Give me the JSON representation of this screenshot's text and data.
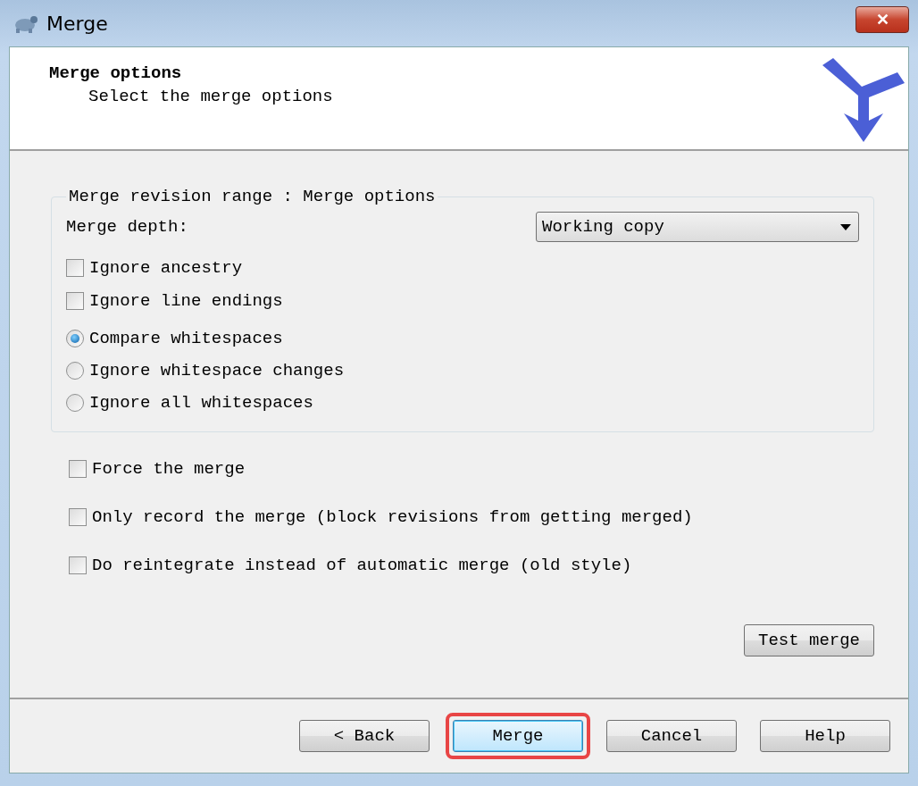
{
  "window": {
    "title": "Merge",
    "close_button": "✕"
  },
  "header": {
    "title": "Merge options",
    "subtitle": "Select the merge options"
  },
  "group": {
    "legend": "Merge revision range : Merge options",
    "depth_label": "Merge depth:",
    "depth_value": "Working copy",
    "checkboxes": [
      {
        "label": "Ignore ancestry",
        "checked": false
      },
      {
        "label": "Ignore line endings",
        "checked": false
      }
    ],
    "radios": [
      {
        "label": "Compare whitespaces",
        "selected": true
      },
      {
        "label": "Ignore whitespace changes",
        "selected": false
      },
      {
        "label": "Ignore all whitespaces",
        "selected": false
      }
    ]
  },
  "options": [
    {
      "label": "Force the merge",
      "checked": false
    },
    {
      "label": "Only record the merge (block revisions from getting merged)",
      "checked": false
    },
    {
      "label": "Do reintegrate instead of automatic merge (old style)",
      "checked": false
    }
  ],
  "test_button": "Test merge",
  "buttons": [
    {
      "label": "< Back",
      "default": false,
      "highlighted": false
    },
    {
      "label": "Merge",
      "default": true,
      "highlighted": true
    },
    {
      "label": "Cancel",
      "default": false,
      "highlighted": false
    },
    {
      "label": "Help",
      "default": false,
      "highlighted": false
    }
  ]
}
